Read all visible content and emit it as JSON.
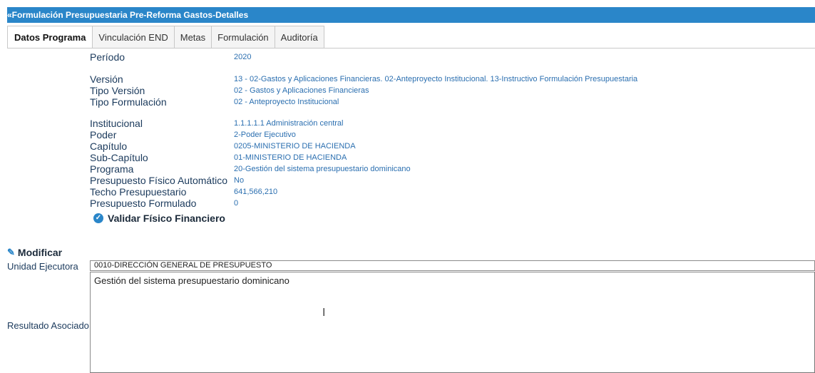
{
  "window": {
    "title": "«Formulación Presupuestaria Pre-Reforma Gastos-Detalles"
  },
  "tabs": [
    {
      "label": "Datos Programa"
    },
    {
      "label": "Vinculación END"
    },
    {
      "label": "Metas"
    },
    {
      "label": "Formulación"
    },
    {
      "label": "Auditoría"
    }
  ],
  "details": {
    "periodo": {
      "label": "Período",
      "value": "2020"
    },
    "version": {
      "label": "Versión",
      "value": "13 - 02-Gastos y Aplicaciones Financieras. 02-Anteproyecto Institucional. 13-Instructivo Formulación Presupuestaria"
    },
    "tipo_version": {
      "label": "Tipo Versión",
      "value": "02 - Gastos y Aplicaciones Financieras"
    },
    "tipo_formulacion": {
      "label": "Tipo Formulación",
      "value": "02 - Anteproyecto Institucional"
    },
    "institucional": {
      "label": "Institucional",
      "value": "1.1.1.1.1 Administración central"
    },
    "poder": {
      "label": "Poder",
      "value": "2-Poder Ejecutivo"
    },
    "capitulo": {
      "label": "Capítulo",
      "value": "0205-MINISTERIO DE HACIENDA"
    },
    "sub_capitulo": {
      "label": "Sub-Capítulo",
      "value": "01-MINISTERIO DE HACIENDA"
    },
    "programa": {
      "label": "Programa",
      "value": "20-Gestión del sistema presupuestario dominicano"
    },
    "presupuesto_fisico": {
      "label": "Presupuesto Físico Automático",
      "value": "No"
    },
    "techo": {
      "label": "Techo Presupuestario",
      "value": "641,566,210"
    },
    "formulado": {
      "label": "Presupuesto Formulado",
      "value": "0"
    }
  },
  "actions": {
    "validar": "Validar Físico Financiero",
    "modificar": "Modificar"
  },
  "form": {
    "unidad_label": "Unidad Ejecutora",
    "unidad_value": "0010-DIRECCIÓN GENERAL DE PRESUPUESTO",
    "resultado_label": "Resultado Asociado",
    "resultado_value": "Gestión del sistema presupuestario dominicano"
  },
  "icons": {
    "check": "check-circle-icon",
    "pencil": "pencil-icon",
    "cursor": "text-cursor-icon"
  },
  "colors": {
    "title_bar": "#2a86c9",
    "value_text": "#2b6fb0",
    "label_text": "#1b3a5c"
  }
}
